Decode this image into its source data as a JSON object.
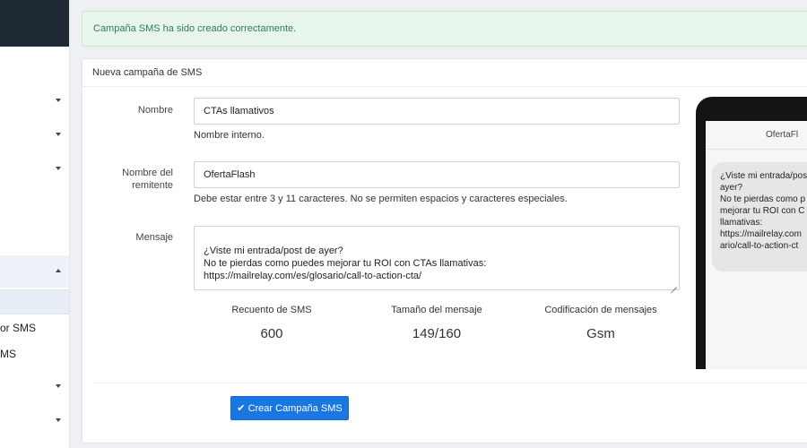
{
  "sidebar": {
    "items": [
      {
        "label": "or SMS"
      },
      {
        "label": "MS"
      }
    ]
  },
  "alert": {
    "message": "Campaña SMS ha sido creado correctamente."
  },
  "card": {
    "title": "Nueva campaña de SMS"
  },
  "form": {
    "nombre": {
      "label": "Nombre",
      "value": "CTAs llamativos",
      "help": "Nombre interno."
    },
    "remitente": {
      "label_line1": "Nombre del",
      "label_line2": "remitente",
      "value": "OfertaFlash",
      "help": "Debe estar entre 3 y 11 caracteres. No se permiten espacios y caracteres especiales."
    },
    "mensaje": {
      "label": "Mensaje",
      "value": "¿Viste mi entrada/post de ayer?\nNo te pierdas como puedes mejorar tu ROI con CTAs llamativas:\nhttps://mailrelay.com/es/glosario/call-to-action-cta/"
    }
  },
  "stats": [
    {
      "label": "Recuento de SMS",
      "value": "600"
    },
    {
      "label": "Tamaño del mensaje",
      "value": "149/160"
    },
    {
      "label": "Codificación de mensajes",
      "value": "Gsm"
    }
  ],
  "submit": {
    "label": "Crear Campaña SMS",
    "icon": "check-icon"
  },
  "preview": {
    "sender": "OfertaFl",
    "message": "¿Viste mi entrada/pos\nayer?\nNo te pierdas como p\nmejorar tu ROI con C\nllamativas:\nhttps://mailrelay.com\nario/call-to-action-ct"
  }
}
